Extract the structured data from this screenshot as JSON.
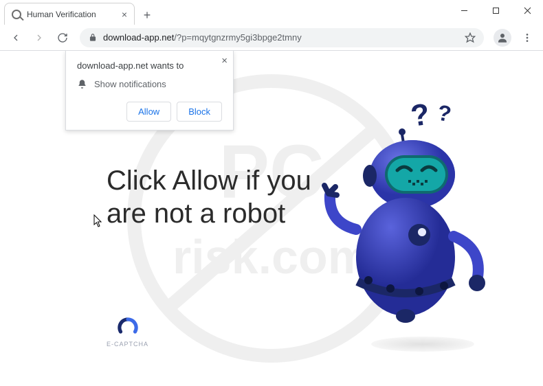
{
  "tab": {
    "title": "Human Verification"
  },
  "address": {
    "domain": "download-app.net",
    "path": "/?p=mqytgnzrmy5gi3bpge2tmny"
  },
  "permission": {
    "host_text": "download-app.net wants to",
    "item": "Show notifications",
    "allow": "Allow",
    "block": "Block"
  },
  "page": {
    "headline": "Click Allow if you are not a robot",
    "captcha_label": "E-CAPTCHA"
  },
  "watermark": {
    "top": "PC",
    "bottom": "risk.com"
  }
}
